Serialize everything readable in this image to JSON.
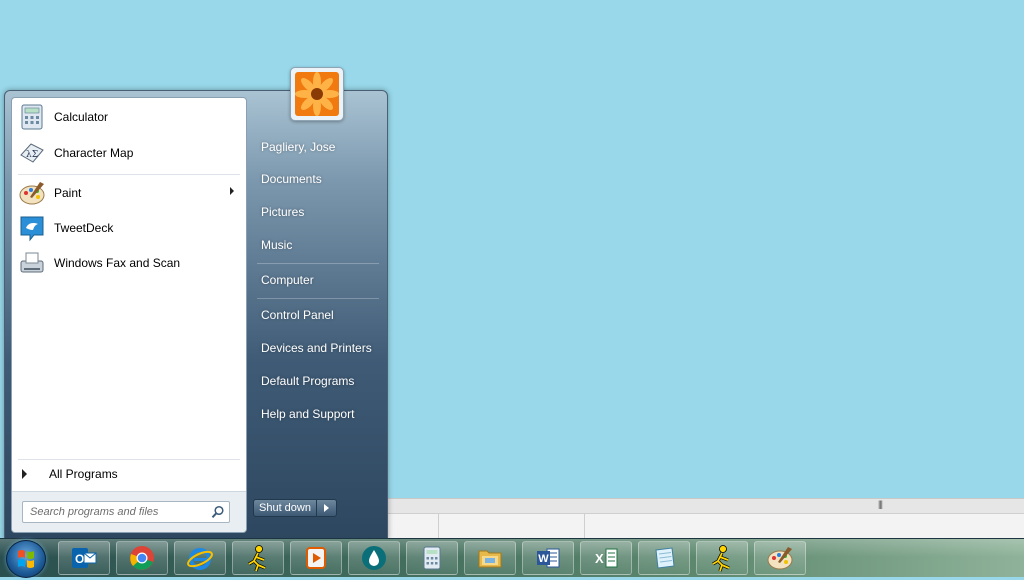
{
  "start_menu": {
    "pinned_programs": [
      {
        "label": "Calculator",
        "icon": "calculator-icon"
      },
      {
        "label": "Character Map",
        "icon": "character-map-icon"
      }
    ],
    "recent_programs": [
      {
        "label": "Paint",
        "icon": "paint-icon",
        "has_submenu": true
      },
      {
        "label": "TweetDeck",
        "icon": "tweetdeck-icon"
      },
      {
        "label": "Windows Fax and Scan",
        "icon": "fax-scan-icon"
      }
    ],
    "all_programs_label": "All Programs",
    "search_placeholder": "Search programs and files",
    "user_picture": "flower-icon",
    "right_items": {
      "user": "Pagliery, Jose",
      "documents": "Documents",
      "pictures": "Pictures",
      "music": "Music",
      "computer": "Computer",
      "control_panel": "Control Panel",
      "devices_printers": "Devices and Printers",
      "default_programs": "Default Programs",
      "help_support": "Help and Support"
    },
    "shutdown_label": "Shut down"
  },
  "taskbar": {
    "start_button": "windows-logo-icon",
    "buttons": [
      "outlook-icon",
      "chrome-icon",
      "internet-explorer-icon",
      "aim-icon",
      "media-player-icon",
      "droplet-app-icon",
      "calculator-icon",
      "file-explorer-icon",
      "word-icon",
      "excel-icon",
      "notepad-icon",
      "aim-icon",
      "paint-icon"
    ]
  },
  "colors": {
    "desktop": "#98d8ea",
    "menu_right_pane": "#3f5b76",
    "taskbar": "#3f6a5b"
  }
}
